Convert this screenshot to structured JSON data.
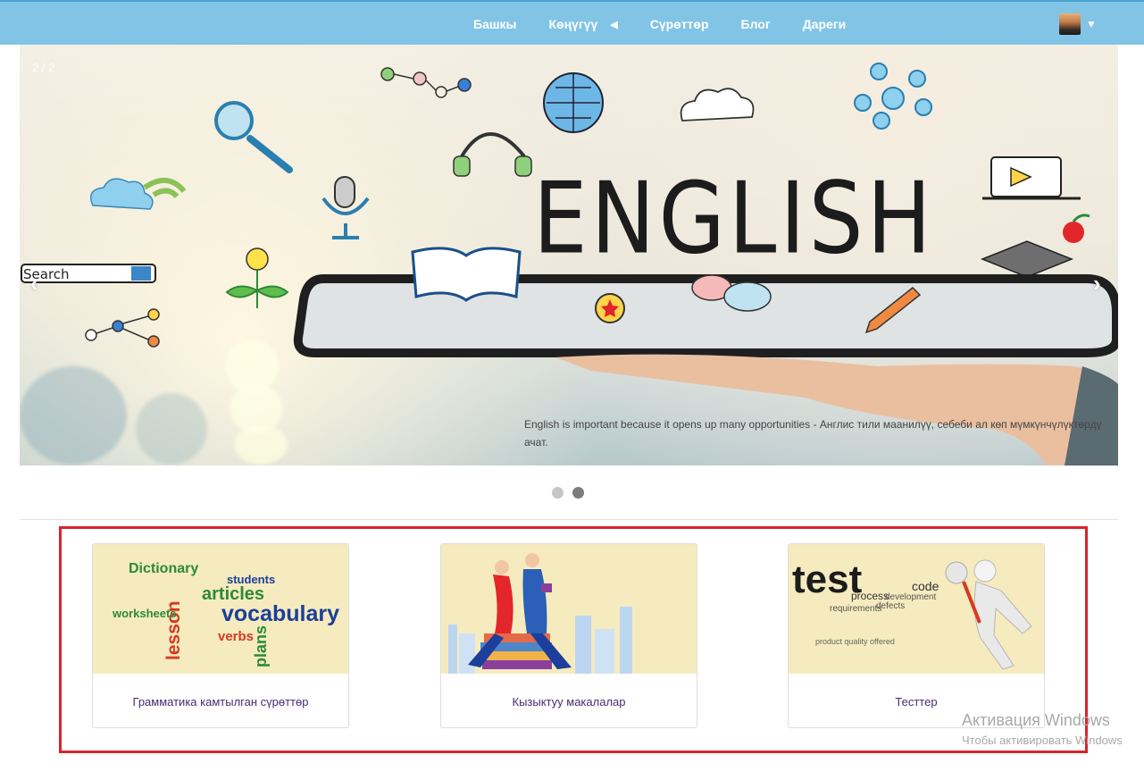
{
  "nav": {
    "items": [
      {
        "label": "Башкы"
      },
      {
        "label": "Көңүгүү",
        "caret": "◀"
      },
      {
        "label": "Сүрөттөр"
      },
      {
        "label": "Блог"
      },
      {
        "label": "Дареги"
      }
    ],
    "avatar_caret": "▼"
  },
  "carousel": {
    "counter": "2 / 2",
    "prev": "‹",
    "next": "›",
    "headline": "ENGLISH",
    "search_doodle": "Search",
    "caption": "English is important because it opens up many opportunities - Англис тили маанилүү, себеби ал көп мүмкүнчүлүктөрдү ачат.",
    "slide_count": 2,
    "active_slide": 2
  },
  "cards": [
    {
      "label": "Грамматика камтылган сүрөттөр",
      "thumb_words": [
        "Dictionary",
        "articles",
        "vocabulary",
        "lesson",
        "worksheets",
        "verbs",
        "plans",
        "students"
      ]
    },
    {
      "label": "Кызыктуу макалалар"
    },
    {
      "label": "Тесттер",
      "thumb_words": [
        "test",
        "code",
        "process",
        "development",
        "requirements",
        "defects"
      ]
    }
  ],
  "watermark": {
    "line1": "Активация Windows",
    "line2": "Чтобы активировать Windows"
  },
  "colors": {
    "topbar": "#82c4e6",
    "highlight_border": "#d9232d",
    "card_label": "#4a2a72",
    "thumb_bg": "#f5ebbe"
  }
}
